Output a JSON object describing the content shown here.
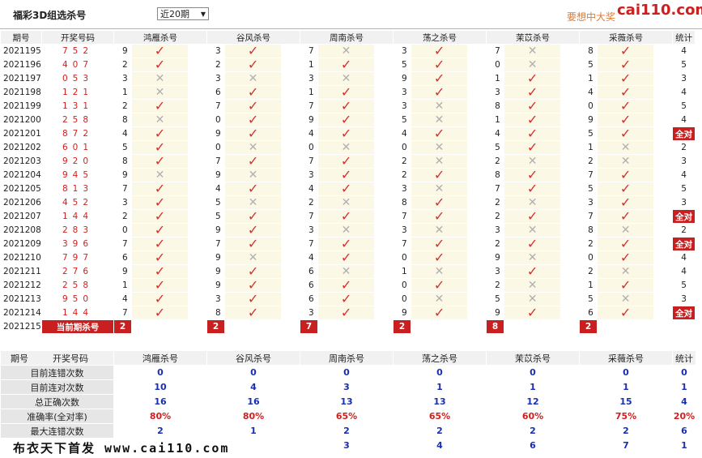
{
  "header": {
    "title": "福彩3D组选杀号",
    "period_select": "近20期",
    "slogan": "要想中大奖",
    "brand": "cai110.com"
  },
  "columns": {
    "issue": "期号",
    "numbers": "开奖号码",
    "experts": [
      "鸿雁杀号",
      "谷风杀号",
      "周南杀号",
      "荡之杀号",
      "茉苡杀号",
      "采薇杀号"
    ],
    "stat": "统计"
  },
  "rows": [
    {
      "issue": "2021195",
      "nums": "752",
      "kills": [
        "9",
        "3",
        "7",
        "3",
        "7",
        "8"
      ],
      "hits": [
        1,
        1,
        0,
        1,
        0,
        1
      ],
      "stat": "4"
    },
    {
      "issue": "2021196",
      "nums": "407",
      "kills": [
        "2",
        "2",
        "1",
        "5",
        "0",
        "5"
      ],
      "hits": [
        1,
        1,
        1,
        1,
        0,
        1
      ],
      "stat": "5"
    },
    {
      "issue": "2021197",
      "nums": "053",
      "kills": [
        "3",
        "3",
        "3",
        "9",
        "1",
        "1"
      ],
      "hits": [
        0,
        0,
        0,
        1,
        1,
        1
      ],
      "stat": "3"
    },
    {
      "issue": "2021198",
      "nums": "121",
      "kills": [
        "1",
        "6",
        "1",
        "3",
        "3",
        "4"
      ],
      "hits": [
        0,
        1,
        1,
        1,
        1,
        1
      ],
      "stat": "4"
    },
    {
      "issue": "2021199",
      "nums": "131",
      "kills": [
        "2",
        "7",
        "7",
        "3",
        "8",
        "0"
      ],
      "hits": [
        1,
        1,
        1,
        0,
        1,
        1
      ],
      "stat": "5"
    },
    {
      "issue": "2021200",
      "nums": "258",
      "kills": [
        "8",
        "0",
        "9",
        "5",
        "1",
        "9"
      ],
      "hits": [
        0,
        1,
        1,
        0,
        1,
        1
      ],
      "stat": "4"
    },
    {
      "issue": "2021201",
      "nums": "872",
      "kills": [
        "4",
        "9",
        "4",
        "4",
        "4",
        "5"
      ],
      "hits": [
        1,
        1,
        1,
        1,
        1,
        1
      ],
      "stat": "全对"
    },
    {
      "issue": "2021202",
      "nums": "601",
      "kills": [
        "5",
        "0",
        "0",
        "0",
        "5",
        "1"
      ],
      "hits": [
        1,
        0,
        0,
        0,
        1,
        0
      ],
      "stat": "2"
    },
    {
      "issue": "2021203",
      "nums": "920",
      "kills": [
        "8",
        "7",
        "7",
        "2",
        "2",
        "2"
      ],
      "hits": [
        1,
        1,
        1,
        0,
        0,
        0
      ],
      "stat": "3"
    },
    {
      "issue": "2021204",
      "nums": "945",
      "kills": [
        "9",
        "9",
        "3",
        "2",
        "8",
        "7"
      ],
      "hits": [
        0,
        0,
        1,
        1,
        1,
        1
      ],
      "stat": "4"
    },
    {
      "issue": "2021205",
      "nums": "813",
      "kills": [
        "7",
        "4",
        "4",
        "3",
        "7",
        "5"
      ],
      "hits": [
        1,
        1,
        1,
        0,
        1,
        1
      ],
      "stat": "5"
    },
    {
      "issue": "2021206",
      "nums": "452",
      "kills": [
        "3",
        "5",
        "2",
        "8",
        "2",
        "3"
      ],
      "hits": [
        1,
        0,
        0,
        1,
        0,
        1
      ],
      "stat": "3"
    },
    {
      "issue": "2021207",
      "nums": "144",
      "kills": [
        "2",
        "5",
        "7",
        "7",
        "2",
        "7"
      ],
      "hits": [
        1,
        1,
        1,
        1,
        1,
        1
      ],
      "stat": "全对"
    },
    {
      "issue": "2021208",
      "nums": "283",
      "kills": [
        "0",
        "9",
        "3",
        "3",
        "3",
        "8"
      ],
      "hits": [
        1,
        1,
        0,
        0,
        0,
        0
      ],
      "stat": "2"
    },
    {
      "issue": "2021209",
      "nums": "396",
      "kills": [
        "7",
        "7",
        "7",
        "7",
        "2",
        "2"
      ],
      "hits": [
        1,
        1,
        1,
        1,
        1,
        1
      ],
      "stat": "全对"
    },
    {
      "issue": "2021210",
      "nums": "797",
      "kills": [
        "6",
        "9",
        "4",
        "0",
        "9",
        "0"
      ],
      "hits": [
        1,
        0,
        1,
        1,
        0,
        1
      ],
      "stat": "4"
    },
    {
      "issue": "2021211",
      "nums": "276",
      "kills": [
        "9",
        "9",
        "6",
        "1",
        "3",
        "2"
      ],
      "hits": [
        1,
        1,
        0,
        0,
        1,
        0
      ],
      "stat": "4"
    },
    {
      "issue": "2021212",
      "nums": "258",
      "kills": [
        "1",
        "9",
        "6",
        "0",
        "2",
        "1"
      ],
      "hits": [
        1,
        1,
        1,
        1,
        0,
        1
      ],
      "stat": "5"
    },
    {
      "issue": "2021213",
      "nums": "950",
      "kills": [
        "4",
        "3",
        "6",
        "0",
        "5",
        "5"
      ],
      "hits": [
        1,
        1,
        1,
        0,
        0,
        0
      ],
      "stat": "3"
    },
    {
      "issue": "2021214",
      "nums": "144",
      "kills": [
        "7",
        "8",
        "3",
        "9",
        "9",
        "6"
      ],
      "hits": [
        1,
        1,
        1,
        1,
        1,
        1
      ],
      "stat": "全对"
    }
  ],
  "current": {
    "issue": "2021215",
    "label": "当前期杀号",
    "kills": [
      "2",
      "2",
      "7",
      "2",
      "8",
      "2"
    ]
  },
  "stats": {
    "header": {
      "issue": "期号",
      "numbers": "开奖号码",
      "stat": "统计"
    },
    "rows": [
      {
        "label": "目前连错次数",
        "vals": [
          "0",
          "0",
          "0",
          "0",
          "0",
          "0"
        ],
        "stat": "0",
        "style": "blue"
      },
      {
        "label": "目前连对次数",
        "vals": [
          "10",
          "4",
          "3",
          "1",
          "1",
          "1"
        ],
        "stat": "1",
        "style": "blue"
      },
      {
        "label": "总正确次数",
        "vals": [
          "16",
          "16",
          "13",
          "13",
          "12",
          "15"
        ],
        "stat": "4",
        "style": "blue"
      },
      {
        "label": "准确率(全对率)",
        "vals": [
          "80%",
          "80%",
          "65%",
          "65%",
          "60%",
          "75%"
        ],
        "stat": "20%",
        "style": "red"
      },
      {
        "label": "最大连错次数",
        "vals": [
          "2",
          "1",
          "2",
          "2",
          "2",
          "2"
        ],
        "stat": "6",
        "style": "blue"
      },
      {
        "label": "",
        "vals": [
          "",
          "",
          "3",
          "4",
          "6",
          "7"
        ],
        "stat": "1",
        "style": "blue"
      }
    ]
  },
  "footer": "布衣天下首发 www.cai110.com",
  "colors": {
    "accent": "#c82020",
    "hit": "#d63030",
    "miss": "#b0b0b0",
    "stat_blue": "#1a2fb0"
  }
}
